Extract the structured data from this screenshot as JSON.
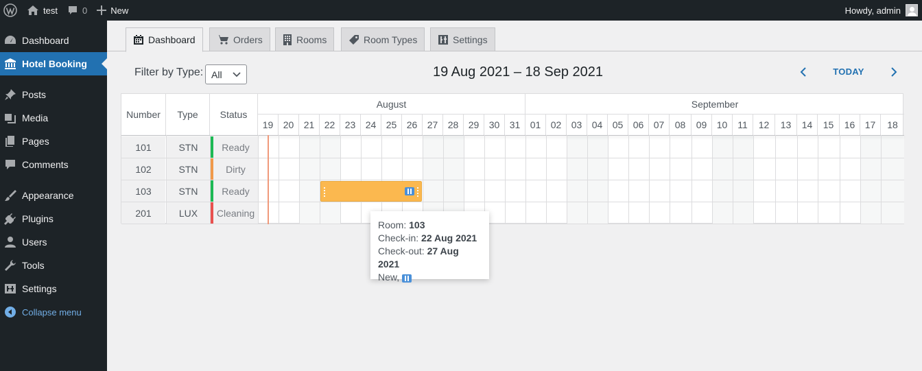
{
  "adminbar": {
    "wp_logo": "wordpress-logo-icon",
    "site_name": "test",
    "comments_count": "0",
    "new_label": "New",
    "howdy": "Howdy, admin"
  },
  "sidebar": {
    "items": [
      {
        "label": "Dashboard",
        "icon": "dashboard-icon"
      },
      {
        "label": "Hotel Booking",
        "icon": "bank-icon"
      },
      {
        "label": "Posts",
        "icon": "pin-icon"
      },
      {
        "label": "Media",
        "icon": "media-icon"
      },
      {
        "label": "Pages",
        "icon": "pages-icon"
      },
      {
        "label": "Comments",
        "icon": "comment-icon"
      },
      {
        "label": "Appearance",
        "icon": "brush-icon"
      },
      {
        "label": "Plugins",
        "icon": "plugin-icon"
      },
      {
        "label": "Users",
        "icon": "user-icon"
      },
      {
        "label": "Tools",
        "icon": "wrench-icon"
      },
      {
        "label": "Settings",
        "icon": "settings-icon"
      },
      {
        "label": "Collapse menu",
        "icon": "collapse-icon"
      }
    ]
  },
  "tabs": [
    {
      "label": "Dashboard",
      "icon": "calendar-icon"
    },
    {
      "label": "Orders",
      "icon": "cart-icon"
    },
    {
      "label": "Rooms",
      "icon": "building-icon"
    },
    {
      "label": "Room Types",
      "icon": "tag-icon"
    },
    {
      "label": "Settings",
      "icon": "sliders-icon"
    }
  ],
  "toolbar": {
    "filter_label": "Filter by Type:",
    "filter_value": "All",
    "range_title": "19 Aug 2021 – 18 Sep 2021",
    "today_label": "TODAY"
  },
  "calendar": {
    "headers": {
      "number": "Number",
      "type": "Type",
      "status": "Status"
    },
    "months": [
      {
        "name": "August"
      },
      {
        "name": "September"
      }
    ],
    "days": [
      "19",
      "20",
      "21",
      "22",
      "23",
      "24",
      "25",
      "26",
      "27",
      "28",
      "29",
      "30",
      "31",
      "01",
      "02",
      "03",
      "04",
      "05",
      "06",
      "07",
      "08",
      "09",
      "10",
      "11",
      "12",
      "13",
      "14",
      "15",
      "16",
      "17",
      "18"
    ],
    "rooms": [
      {
        "number": "101",
        "type": "STN",
        "status": "Ready",
        "status_color": "#1db954"
      },
      {
        "number": "102",
        "type": "STN",
        "status": "Dirty",
        "status_color": "#f0994a"
      },
      {
        "number": "103",
        "type": "STN",
        "status": "Ready",
        "status_color": "#1db954"
      },
      {
        "number": "201",
        "type": "LUX",
        "status": "Cleaning",
        "status_color": "#e8514f"
      }
    ],
    "booking": {
      "room": "103",
      "color": "#fbb84f"
    }
  },
  "tooltip": {
    "room_label": "Room:",
    "room_value": "103",
    "checkin_label": "Check-in:",
    "checkin_value": "22 Aug 2021",
    "checkout_label": "Check-out:",
    "checkout_value": "27 Aug 2021",
    "status_text": "New,"
  }
}
